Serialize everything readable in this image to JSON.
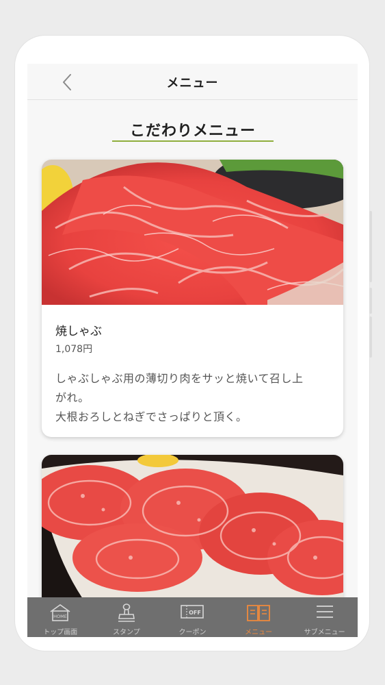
{
  "header": {
    "title": "メニュー"
  },
  "section": {
    "title": "こだわりメニュー"
  },
  "menu_items": [
    {
      "name": "焼しゃぶ",
      "price": "1,078円",
      "description_lines": [
        "しゃぶしゃぶ用の薄切り肉をサッと焼いて召し上",
        "がれ。",
        "大根おろしとねぎでさっぱりと頂く。"
      ]
    },
    {}
  ],
  "tabs": [
    {
      "label": "トップ画面",
      "icon": "home-icon",
      "icon_text": "HOME",
      "active": false
    },
    {
      "label": "スタンプ",
      "icon": "stamp-icon",
      "active": false
    },
    {
      "label": "クーポン",
      "icon": "coupon-icon",
      "icon_text": "OFF",
      "active": false
    },
    {
      "label": "メニュー",
      "icon": "menu-book-icon",
      "active": true
    },
    {
      "label": "サブメニュー",
      "icon": "hamburger-icon",
      "active": false
    }
  ],
  "colors": {
    "accent_underline": "#8fae3c",
    "tab_active": "#f08a3c",
    "tab_bar_bg": "#6f6f6f"
  }
}
